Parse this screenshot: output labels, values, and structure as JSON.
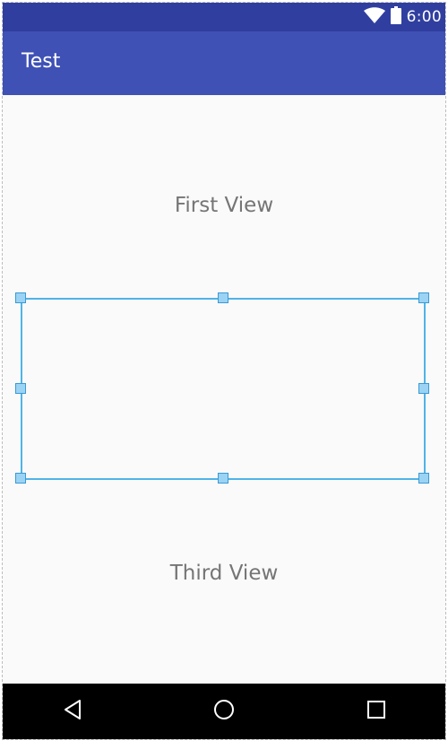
{
  "status_bar": {
    "time": "6:00",
    "icons": [
      "wifi-icon",
      "battery-icon"
    ],
    "background": "#303f9f"
  },
  "app_bar": {
    "title": "Test",
    "background": "#3f51b5"
  },
  "content": {
    "first_view": "First View",
    "third_view": "Third View",
    "selection_color": "#4fb3e8"
  },
  "nav_bar": {
    "buttons": [
      "back-icon",
      "home-icon",
      "recents-icon"
    ]
  }
}
